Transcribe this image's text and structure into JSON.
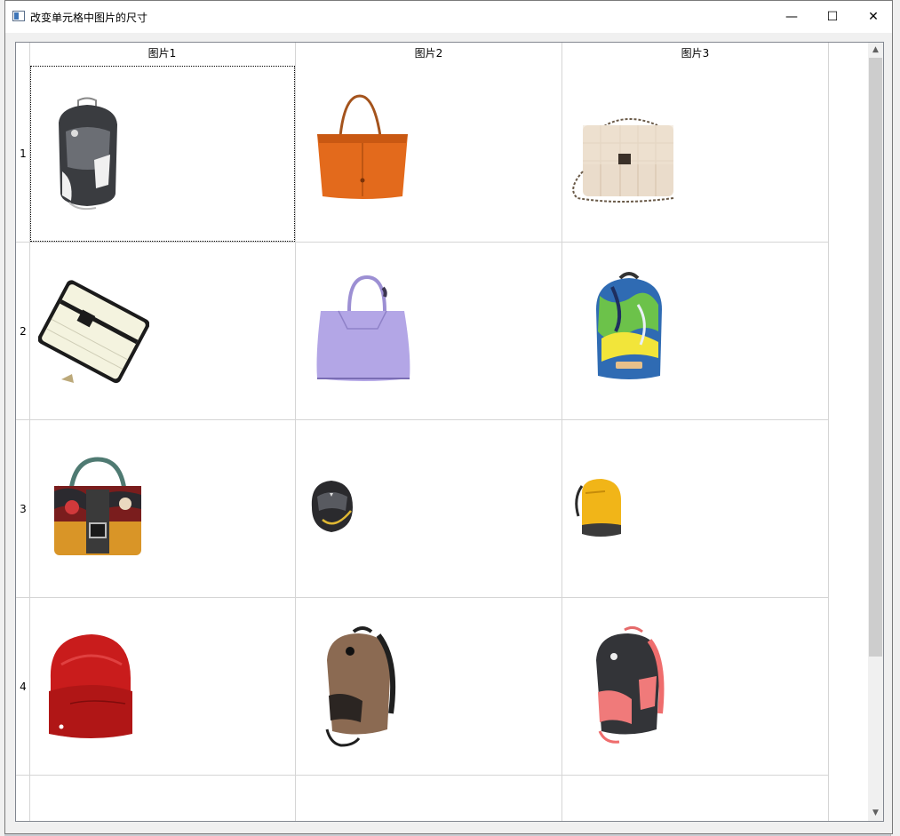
{
  "window": {
    "title": "改变单元格中图片的尺寸",
    "controls": {
      "minimize": "—",
      "maximize": "☐",
      "close": "✕"
    }
  },
  "grid": {
    "columns": [
      "图片1",
      "图片2",
      "图片3"
    ],
    "rows": [
      "1",
      "2",
      "3",
      "4",
      ""
    ],
    "cells": [
      [
        {
          "item": "gray-backpack"
        },
        {
          "item": "orange-tote"
        },
        {
          "item": "cream-chain-bag"
        }
      ],
      [
        {
          "item": "cream-wallet"
        },
        {
          "item": "lavender-handbag"
        },
        {
          "item": "colorful-backpack"
        }
      ],
      [
        {
          "item": "patterned-handbag"
        },
        {
          "item": "black-helmet-backpack"
        },
        {
          "item": "yellow-backpack"
        }
      ],
      [
        {
          "item": "red-backpack"
        },
        {
          "item": "brown-backpack"
        },
        {
          "item": "pink-black-backpack"
        }
      ]
    ]
  },
  "scrollbar": {
    "up": "▲",
    "down": "▼"
  }
}
